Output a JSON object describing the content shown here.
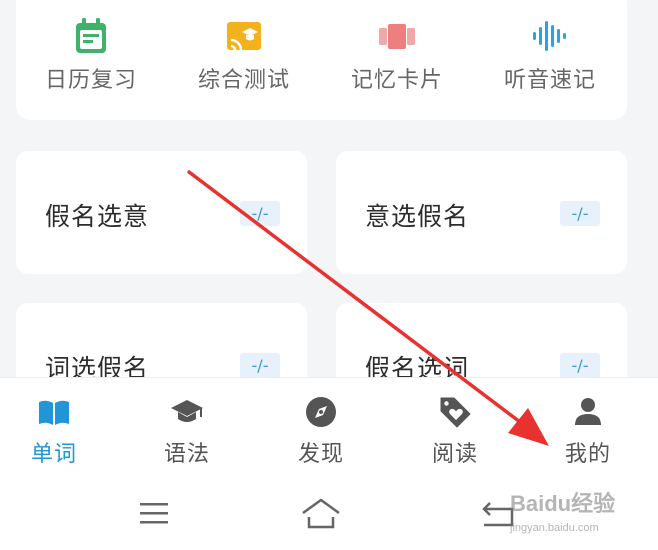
{
  "tools": [
    {
      "label": "日历复习",
      "icon": "calendar-icon",
      "color": "#3fb26a"
    },
    {
      "label": "综合测试",
      "icon": "test-cast-icon",
      "color": "#f2b21c"
    },
    {
      "label": "记忆卡片",
      "icon": "cards-icon",
      "color": "#ee8888"
    },
    {
      "label": "听音速记",
      "icon": "sound-wave-icon",
      "color": "#2aa3e0"
    }
  ],
  "quiz_cards": [
    {
      "title": "假名选意",
      "badge": "-/-"
    },
    {
      "title": "意选假名",
      "badge": "-/-"
    },
    {
      "title": "词选假名",
      "badge": "-/-"
    },
    {
      "title": "假名选词",
      "badge": "-/-"
    }
  ],
  "tabbar": {
    "active": "单词",
    "accent": "#2196d6",
    "items": [
      {
        "label": "单词",
        "icon": "book-icon"
      },
      {
        "label": "语法",
        "icon": "graduation-cap-icon"
      },
      {
        "label": "发现",
        "icon": "compass-icon"
      },
      {
        "label": "阅读",
        "icon": "heart-tag-icon"
      },
      {
        "label": "我的",
        "icon": "person-icon"
      }
    ]
  },
  "system_nav": [
    "menu-icon",
    "home-icon",
    "back-icon"
  ],
  "annotation": {
    "arrow_color": "#e8322f"
  },
  "watermark": {
    "top": "Baidu经验",
    "bottom": "jingyan.baidu.com"
  }
}
